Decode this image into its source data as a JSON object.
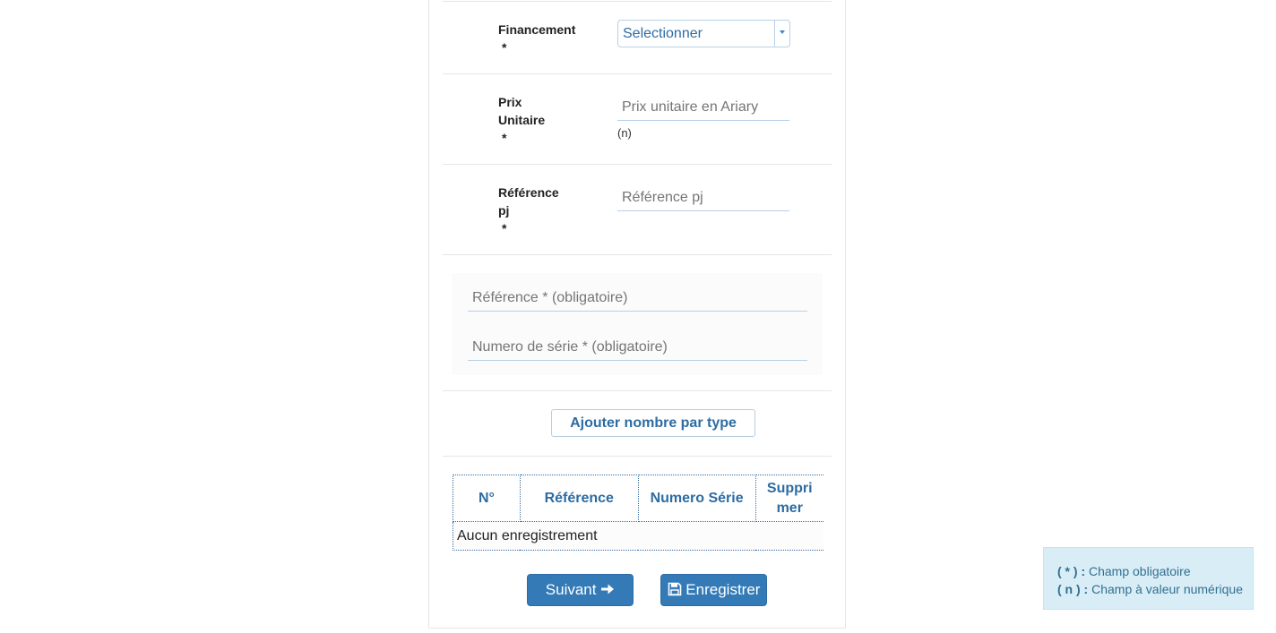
{
  "form": {
    "financement": {
      "label": "Financement",
      "required_mark": "*",
      "selected": "Selectionner"
    },
    "prix_unitaire": {
      "label_line1": "Prix",
      "label_line2": "Unitaire",
      "required_mark": "*",
      "placeholder": "Prix unitaire en Ariary",
      "hint": "(n)"
    },
    "reference_pj": {
      "label_line1": "Référence",
      "label_line2": "pj",
      "required_mark": "*",
      "placeholder": "Référence pj"
    },
    "reference": {
      "placeholder": "Référence * (obligatoire)"
    },
    "numero_serie": {
      "placeholder": "Numero de série * (obligatoire)"
    },
    "add_button": "Ajouter nombre par type"
  },
  "table": {
    "headers": [
      "N°",
      "Référence",
      "Numero Série",
      "Supprimer"
    ],
    "header_delete_line1": "Suppri",
    "header_delete_line2": "mer",
    "empty_text": "Aucun enregistrement"
  },
  "actions": {
    "next": "Suivant",
    "save": "Enregistrer",
    "next_icon": "arrow-right-icon",
    "save_icon": "floppy-disk-icon"
  },
  "legend": {
    "required_key": "( * ) :",
    "required_text": "Champ obligatoire",
    "numeric_key": "( n ) :",
    "numeric_text": "Champ à valeur numérique"
  },
  "colors": {
    "primary": "#337ab7",
    "link_blue": "#2d6ca2",
    "legend_bg": "#d9edf7",
    "legend_text": "#31708f"
  }
}
